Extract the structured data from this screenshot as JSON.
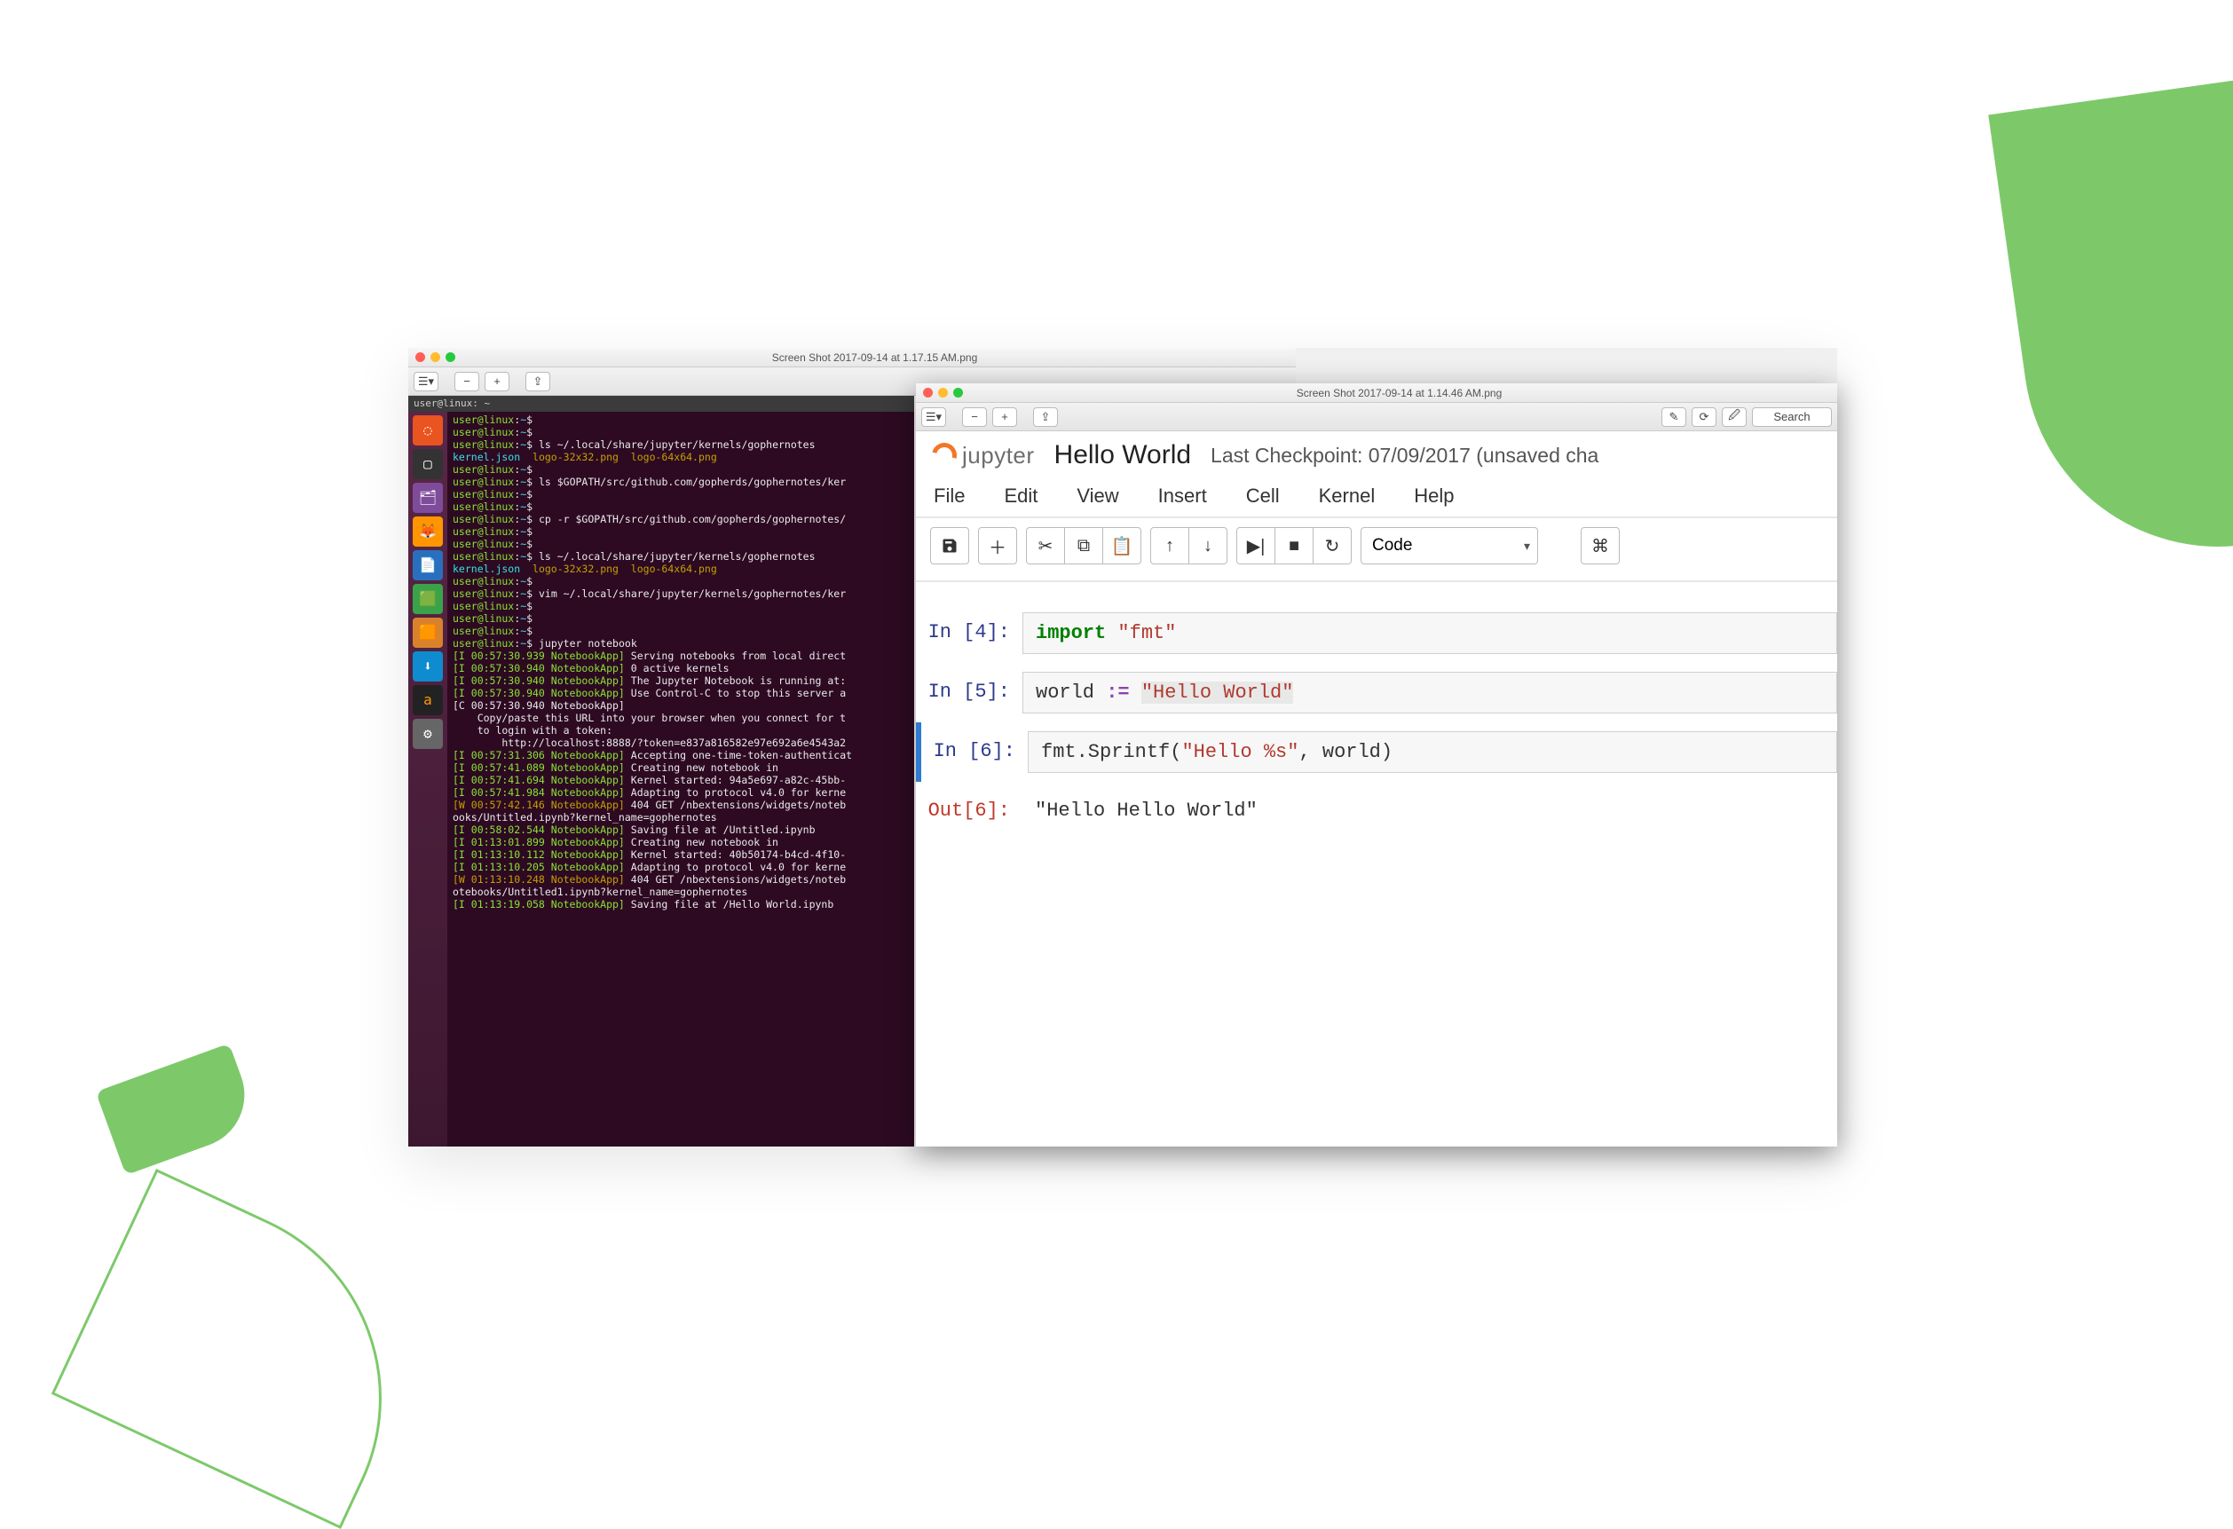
{
  "back_window": {
    "title": "Screen Shot 2017-09-14 at 1.17.15 AM.png"
  },
  "front_window": {
    "title": "Screen Shot 2017-09-14 at 1.14.46 AM.png",
    "toolbar_right_search": "Search"
  },
  "terminal": {
    "titlebar": "user@linux: ~",
    "prompt": "user@linux:~$",
    "lines": [
      "",
      "",
      "ls ~/.local/share/jupyter/kernels/gophernotes",
      "kernel.json  logo-32x32.png  logo-64x64.png",
      "",
      "ls $GOPATH/src/github.com/gopherds/gophernotes/ker",
      "",
      "",
      "cp -r $GOPATH/src/github.com/gopherds/gophernotes/",
      "",
      "",
      "ls ~/.local/share/jupyter/kernels/gophernotes",
      "kernel.json  logo-32x32.png  logo-64x64.png",
      "",
      "vim ~/.local/share/jupyter/kernels/gophernotes/ker",
      "",
      "",
      "",
      "jupyter notebook"
    ],
    "notebookapp": [
      {
        "ts": "[I 00:57:30.939 NotebookApp]",
        "msg": "Serving notebooks from local direct"
      },
      {
        "ts": "[I 00:57:30.940 NotebookApp]",
        "msg": "0 active kernels"
      },
      {
        "ts": "[I 00:57:30.940 NotebookApp]",
        "msg": "The Jupyter Notebook is running at:"
      },
      {
        "ts": "[I 00:57:30.940 NotebookApp]",
        "msg": "Use Control-C to stop this server a"
      },
      {
        "ts": "[C 00:57:30.940 NotebookApp]",
        "msg": ""
      },
      {
        "ts": "",
        "msg": "    Copy/paste this URL into your browser when you connect for t"
      },
      {
        "ts": "",
        "msg": "    to login with a token:"
      },
      {
        "ts": "",
        "msg": "        http://localhost:8888/?token=e837a816582e97e692a6e4543a2"
      },
      {
        "ts": "[I 00:57:31.306 NotebookApp]",
        "msg": "Accepting one-time-token-authenticat"
      },
      {
        "ts": "[I 00:57:41.089 NotebookApp]",
        "msg": "Creating new notebook in"
      },
      {
        "ts": "[I 00:57:41.694 NotebookApp]",
        "msg": "Kernel started: 94a5e697-a82c-45bb-"
      },
      {
        "ts": "[I 00:57:41.984 NotebookApp]",
        "msg": "Adapting to protocol v4.0 for kerne"
      },
      {
        "ts": "[W 00:57:42.146 NotebookApp]",
        "msg": "404 GET /nbextensions/widgets/noteb"
      },
      {
        "ts": "",
        "msg": "ooks/Untitled.ipynb?kernel_name=gophernotes"
      },
      {
        "ts": "[I 00:58:02.544 NotebookApp]",
        "msg": "Saving file at /Untitled.ipynb"
      },
      {
        "ts": "[I 01:13:01.899 NotebookApp]",
        "msg": "Creating new notebook in"
      },
      {
        "ts": "[I 01:13:10.112 NotebookApp]",
        "msg": "Kernel started: 40b50174-b4cd-4f10-"
      },
      {
        "ts": "[I 01:13:10.205 NotebookApp]",
        "msg": "Adapting to protocol v4.0 for kerne"
      },
      {
        "ts": "[W 01:13:10.248 NotebookApp]",
        "msg": "404 GET /nbextensions/widgets/noteb"
      },
      {
        "ts": "",
        "msg": "otebooks/Untitled1.ipynb?kernel_name=gophernotes"
      },
      {
        "ts": "[I 01:13:19.058 NotebookApp]",
        "msg": "Saving file at /Hello World.ipynb"
      }
    ]
  },
  "jupyter": {
    "logo_text": "jupyter",
    "title": "Hello World",
    "checkpoint": "Last Checkpoint: 07/09/2017 (unsaved cha",
    "menus": [
      "File",
      "Edit",
      "View",
      "Insert",
      "Cell",
      "Kernel",
      "Help"
    ],
    "celltype": "Code",
    "cells": [
      {
        "prompt": "In [4]:",
        "code_html": "<span class='kw-green'>import</span> <span class='kw-str'>\"fmt\"</span>"
      },
      {
        "prompt": "In [5]:",
        "code_html": "world <span class='kw-op'>:=</span> <span class='kw-str hl'>\"Hello World\"</span>"
      },
      {
        "prompt": "In [6]:",
        "code_html": "fmt.Sprintf(<span class='kw-str'>\"Hello %s\"</span>, world)",
        "selected": true,
        "out_prompt": "Out[6]:",
        "out_text": "\"Hello Hello World\""
      }
    ]
  }
}
